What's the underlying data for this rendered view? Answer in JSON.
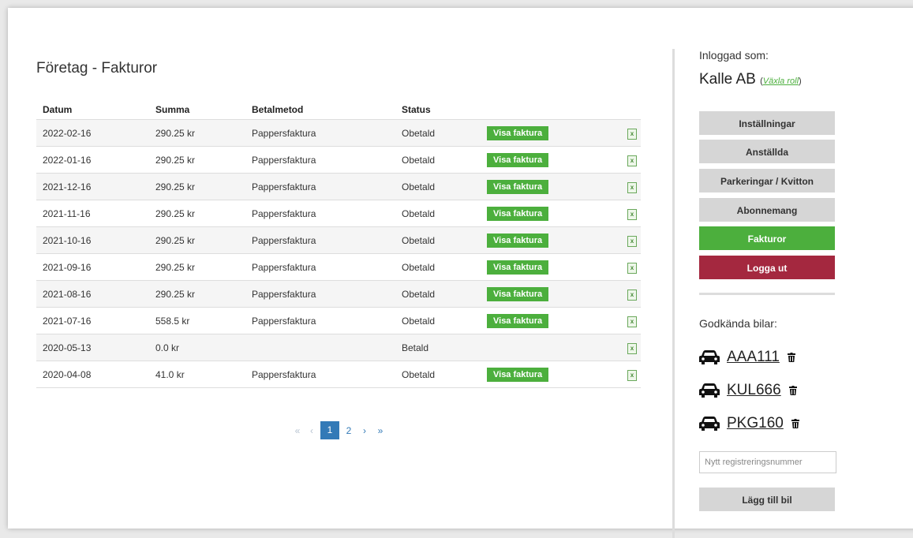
{
  "page": {
    "title": "Företag - Fakturor"
  },
  "table": {
    "headers": {
      "datum": "Datum",
      "summa": "Summa",
      "betalmetod": "Betalmetod",
      "status": "Status"
    },
    "button_label": "Visa faktura",
    "rows": [
      {
        "datum": "2022-02-16",
        "summa": "290.25 kr",
        "betalmetod": "Pappersfaktura",
        "status": "Obetald",
        "show_button": true
      },
      {
        "datum": "2022-01-16",
        "summa": "290.25 kr",
        "betalmetod": "Pappersfaktura",
        "status": "Obetald",
        "show_button": true
      },
      {
        "datum": "2021-12-16",
        "summa": "290.25 kr",
        "betalmetod": "Pappersfaktura",
        "status": "Obetald",
        "show_button": true
      },
      {
        "datum": "2021-11-16",
        "summa": "290.25 kr",
        "betalmetod": "Pappersfaktura",
        "status": "Obetald",
        "show_button": true
      },
      {
        "datum": "2021-10-16",
        "summa": "290.25 kr",
        "betalmetod": "Pappersfaktura",
        "status": "Obetald",
        "show_button": true
      },
      {
        "datum": "2021-09-16",
        "summa": "290.25 kr",
        "betalmetod": "Pappersfaktura",
        "status": "Obetald",
        "show_button": true
      },
      {
        "datum": "2021-08-16",
        "summa": "290.25 kr",
        "betalmetod": "Pappersfaktura",
        "status": "Obetald",
        "show_button": true
      },
      {
        "datum": "2021-07-16",
        "summa": "558.5 kr",
        "betalmetod": "Pappersfaktura",
        "status": "Obetald",
        "show_button": true
      },
      {
        "datum": "2020-05-13",
        "summa": "0.0 kr",
        "betalmetod": "",
        "status": "Betald",
        "show_button": false
      },
      {
        "datum": "2020-04-08",
        "summa": "41.0 kr",
        "betalmetod": "Pappersfaktura",
        "status": "Obetald",
        "show_button": true
      }
    ]
  },
  "pagination": {
    "first": "«",
    "prev": "‹",
    "pages": [
      "1",
      "2"
    ],
    "current": "1",
    "next": "›",
    "last": "»"
  },
  "sidebar": {
    "logged_in_label": "Inloggad som:",
    "user_name": "Kalle AB",
    "switch_role_label": "Växla roll",
    "menu": [
      {
        "label": "Inställningar",
        "state": "normal"
      },
      {
        "label": "Anställda",
        "state": "normal"
      },
      {
        "label": "Parkeringar / Kvitton",
        "state": "normal"
      },
      {
        "label": "Abonnemang",
        "state": "normal"
      },
      {
        "label": "Fakturor",
        "state": "active"
      },
      {
        "label": "Logga ut",
        "state": "logout"
      }
    ],
    "cars_label": "Godkända bilar:",
    "cars": [
      "AAA111",
      "KUL666",
      "PKG160"
    ],
    "reg_placeholder": "Nytt registreringsnummer",
    "add_car_label": "Lägg till bil"
  },
  "colors": {
    "green": "#4caf3d",
    "red": "#a4283f",
    "gray_button": "#d6d6d6",
    "pagination_blue": "#337ab7"
  },
  "icons": {
    "car": "car-icon",
    "trash": "trash-icon",
    "excel": "excel-file-icon"
  }
}
